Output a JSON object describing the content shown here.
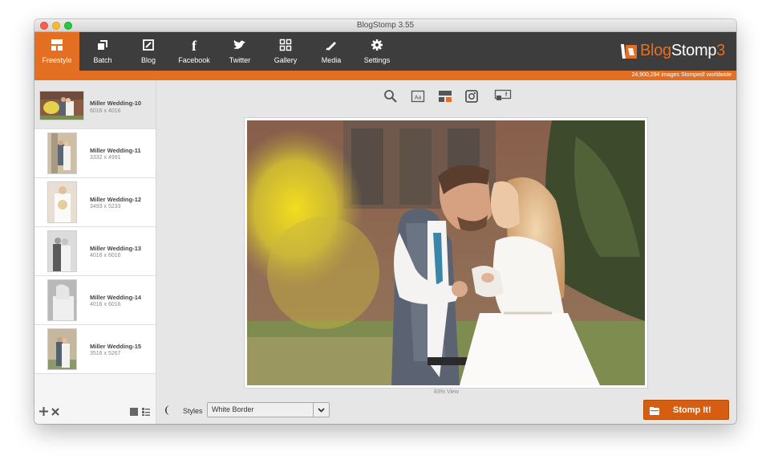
{
  "window": {
    "title": "BlogStomp 3.55"
  },
  "nav": [
    {
      "label": "Freestyle",
      "icon": "freestyle-icon",
      "active": true
    },
    {
      "label": "Batch",
      "icon": "batch-icon"
    },
    {
      "label": "Blog",
      "icon": "blog-icon"
    },
    {
      "label": "Facebook",
      "icon": "facebook-icon"
    },
    {
      "label": "Twitter",
      "icon": "twitter-icon"
    },
    {
      "label": "Gallery",
      "icon": "gallery-icon"
    },
    {
      "label": "Media",
      "icon": "media-icon"
    },
    {
      "label": "Settings",
      "icon": "settings-icon"
    }
  ],
  "brand": {
    "part1": "Blog",
    "part2": "Stomp",
    "part3": "3"
  },
  "status": {
    "stomp_count": "24,900,294 images Stomped! worldwide"
  },
  "images": [
    {
      "name": "Miller Wedding-10",
      "size": "6016 x 4016"
    },
    {
      "name": "Miller Wedding-11",
      "size": "3332 x 4991"
    },
    {
      "name": "Miller Wedding-12",
      "size": "3493 x 5233"
    },
    {
      "name": "Miller Wedding-13",
      "size": "4016 x 6016"
    },
    {
      "name": "Miller Wedding-14",
      "size": "4016 x 6016"
    },
    {
      "name": "Miller Wedding-15",
      "size": "3516 x 5267"
    }
  ],
  "viewer": {
    "zoom_label": "83% View"
  },
  "bottom": {
    "styles_label": "Styles",
    "styles_value": "White Border",
    "stomp_label": "Stomp It!"
  },
  "colors": {
    "accent": "#e37022",
    "toolbar": "#3d3d3d"
  }
}
